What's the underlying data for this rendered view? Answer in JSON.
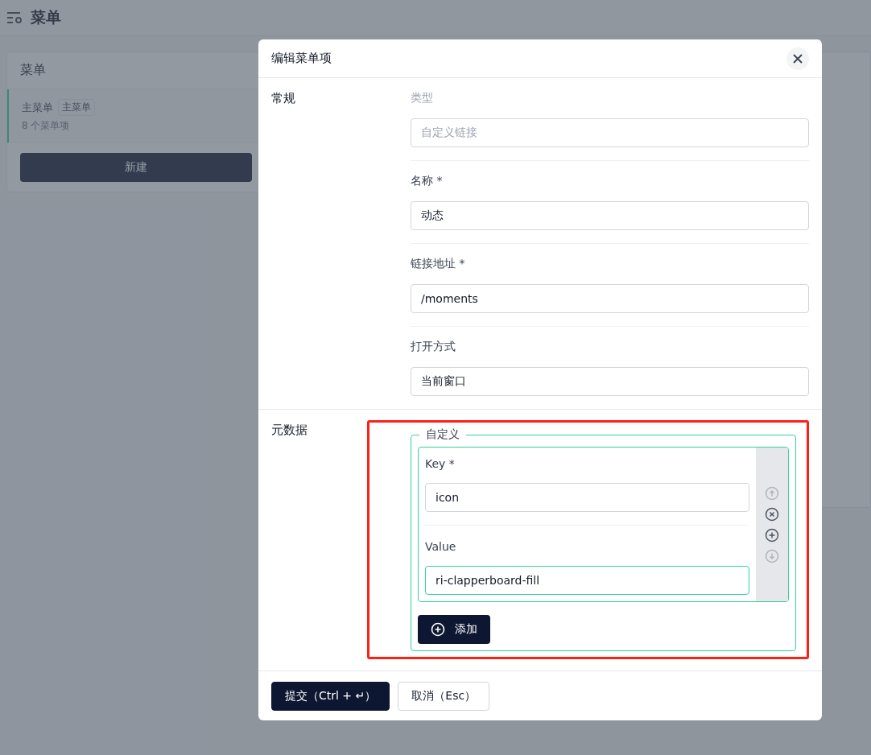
{
  "page": {
    "title": "菜单"
  },
  "menu_card": {
    "title": "菜单",
    "items": [
      {
        "name": "主菜单",
        "tag": "主菜单",
        "count": "8 个菜单项",
        "selected": true
      }
    ],
    "new_button": "新建"
  },
  "dialog": {
    "title": "编辑菜单项",
    "general": {
      "title": "常规",
      "fields": [
        {
          "label": "类型",
          "value": "自定义链接",
          "disabled": true
        },
        {
          "label": "名称 *",
          "value": "动态",
          "disabled": false
        },
        {
          "label": "链接地址 *",
          "value": "/moments",
          "disabled": false
        },
        {
          "label": "打开方式",
          "value": "当前窗口",
          "disabled": false
        }
      ]
    },
    "metadata": {
      "title": "元数据",
      "legend": "自定义",
      "highlighted": true,
      "entries": [
        {
          "fields": [
            {
              "label": "Key *",
              "value": "icon",
              "focused": false
            },
            {
              "label": "Value",
              "value": "ri-clapperboard-fill",
              "focused": true
            }
          ],
          "actions": [
            {
              "kind": "up",
              "disabled": true
            },
            {
              "kind": "remove",
              "disabled": false
            },
            {
              "kind": "add",
              "disabled": false
            },
            {
              "kind": "down",
              "disabled": true
            }
          ]
        }
      ],
      "add_button": "添加"
    },
    "footer_buttons": [
      {
        "label": "提交（Ctrl + ↵）",
        "kind": "primary"
      },
      {
        "label": "取消（Esc）",
        "kind": "secondary"
      }
    ]
  }
}
